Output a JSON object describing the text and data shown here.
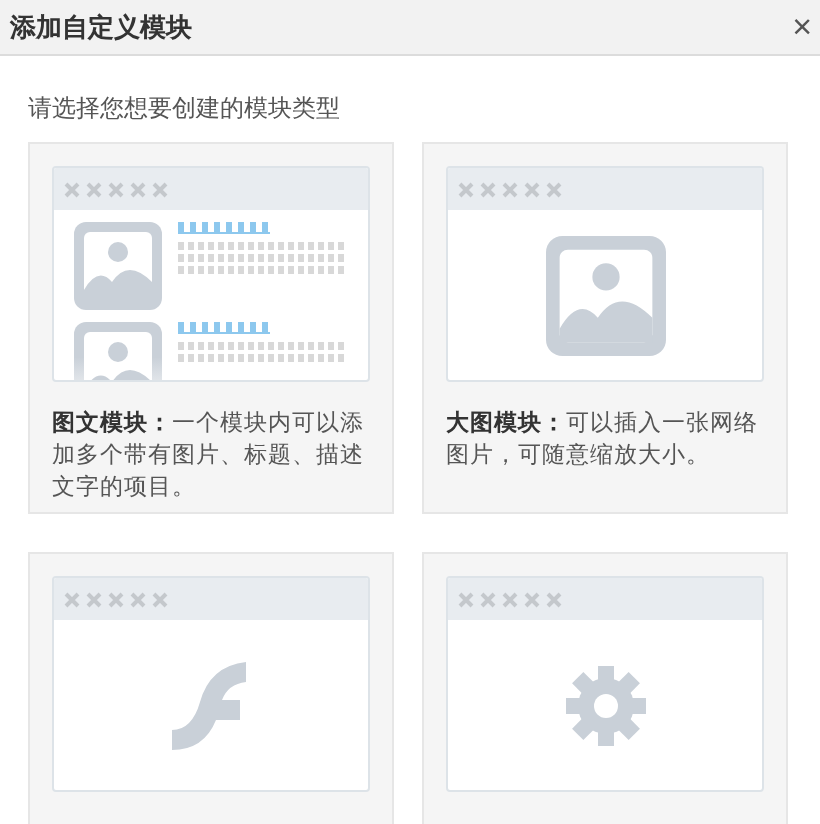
{
  "dialog": {
    "title": "添加自定义模块",
    "close_label": "×"
  },
  "prompt": "请选择您想要创建的模块类型",
  "modules": [
    {
      "kind": "list",
      "description": "**图文模块：**一个模块内可以添加多个带有图片、标题、描述文字的项目。"
    },
    {
      "kind": "image",
      "description": "**大图模块：**可以插入一张网络图片，可随意缩放大小。"
    },
    {
      "kind": "flash"
    },
    {
      "kind": "gear"
    }
  ]
}
